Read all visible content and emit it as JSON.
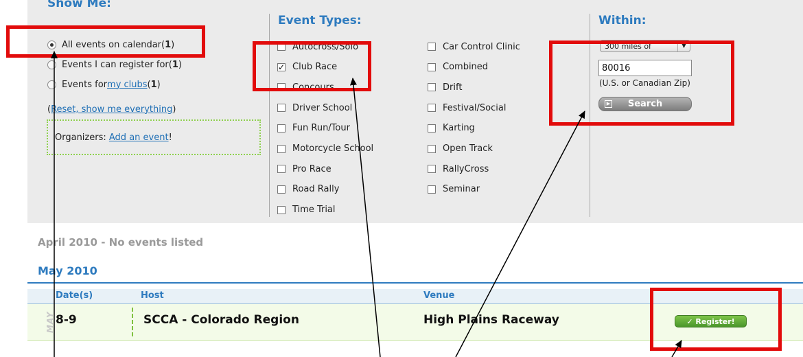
{
  "show_me": {
    "title": "Show Me:",
    "options": [
      {
        "label": "All events on calendar",
        "count_open": " (",
        "count": "1",
        "count_close": ")"
      },
      {
        "label": "Events I can register for",
        "count_open": " (",
        "count": "1",
        "count_close": ")"
      },
      {
        "label": "Events for ",
        "link": "my clubs",
        "count_open": " (",
        "count": "1",
        "count_close": ")"
      }
    ],
    "selected": 0,
    "reset_open": "(",
    "reset_link": "Reset, show me everything",
    "reset_close": ")",
    "organizers_label": "Organizers: ",
    "organizers_link": "Add an event",
    "organizers_tail": "!"
  },
  "event_types": {
    "title": "Event Types:",
    "col1": [
      "Autocross/Solo",
      "Club Race",
      "Concours",
      "Driver School",
      "Fun Run/Tour",
      "Motorcycle School",
      "Pro Race",
      "Road Rally",
      "Time Trial"
    ],
    "col2": [
      "Car Control Clinic",
      "Combined",
      "Drift",
      "Festival/Social",
      "Karting",
      "Open Track",
      "RallyCross",
      "Seminar"
    ],
    "checked": [
      "Club Race"
    ]
  },
  "within": {
    "title": "Within:",
    "distance_value": "300 miles of",
    "zip_value": "80016",
    "zip_hint": "(U.S. or Canadian Zip)",
    "search_label": "Search",
    "search_icon": "arrow-box-icon"
  },
  "calendar": {
    "april_heading": "April 2010 - No events listed",
    "may_heading": "May 2010",
    "columns": {
      "dates": "Date(s)",
      "host": "Host",
      "venue": "Venue"
    },
    "side_month": "MAY",
    "row": {
      "dates": "8-9",
      "host": "SCCA - Colorado Region",
      "venue": "High Plains Raceway",
      "register_label": "✓ Register!"
    }
  },
  "colors": {
    "accent": "#2e7bbf",
    "callout": "#e20b0b",
    "register": "#5aa732"
  }
}
